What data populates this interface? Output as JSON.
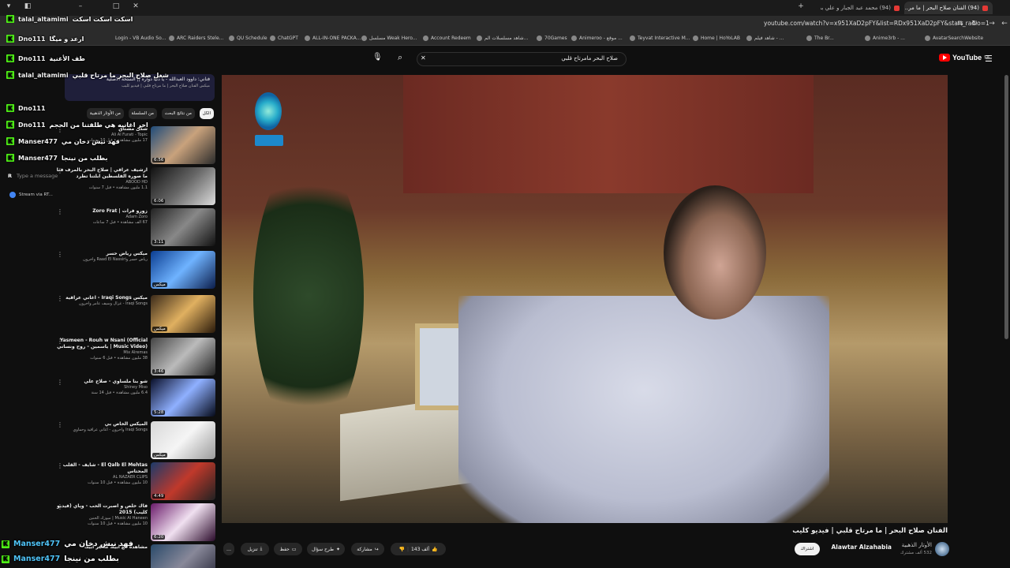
{
  "browser": {
    "tabs": [
      {
        "label": "(94) الفنان صلاح البحر | ما مر...",
        "active": true
      },
      {
        "label": "(94) محمد عبد الجبار و علي بدر ...",
        "active": false
      }
    ],
    "new_tab": "+",
    "url": "youtube.com/watch?v=x951XaD2pFY&list=RDx951XaD2pFY&start_radio=1",
    "bookmarks": [
      "Login - VB Audio So...",
      "ARC Raiders Stele...",
      "QU Schedule",
      "ChatGPT",
      "ALL-IN-ONE PACKA...",
      "مسلسل Weak Hero...",
      "Account Redeem",
      "شاهد مسلسلات الم...",
      "70Games",
      "Animeroo - موقع ...",
      "Teyvat Interactive M...",
      "Home | HoYoLAB",
      "شاهد فيلم - ...",
      "The Br...",
      "Anime3rb - ...",
      "AvatarSearchWebsite"
    ]
  },
  "youtube": {
    "search_value": "صلاح البحر مامرتاح قلبي",
    "logo_text": "YouTube",
    "logo_region": "SA"
  },
  "video": {
    "title": "الفنان صلاح البحر | ما مرتاح قلبي | فيديو كليب",
    "channel_name": "Alawtar Alzahabia",
    "channel_name_ar": "الأوتار الذهبية",
    "channel_subs": "532 ألف مشترك",
    "subscribe_label": "اشتراك",
    "likes": "143 ألف",
    "share_label": "مشاركة",
    "ask_label": "طرح سؤال",
    "save_label": "حفظ",
    "download_label": "تنزيل",
    "more_label": "…"
  },
  "sidebar": {
    "mix_title": "فناني: داوود العبدالله - يا دنيا دواره || النسخة الاصلية",
    "mix_sub": "ميكس الفنان صلاح البحر | ما مرتاح قلبي | فيديو كليب",
    "chips": [
      "الكل",
      "من نتائج البحث",
      "من السلسلة",
      "من الأوتار الذهبية"
    ],
    "recs": [
      {
        "title": "شكل مشتاق",
        "channel": "Ali Al Furati - Topic",
        "meta": "17 مليون مشاهدة • قبل 10 سنوات",
        "duration": "6:56"
      },
      {
        "title": "ارشيف عراقي | صلاح البحر بالمرف فنا ما صوره الفلسطين ابلتنا تطرد",
        "channel": "ABOOD HD",
        "meta": "1.1 مليون مشاهدة • قبل 7 سنوات",
        "duration": "6:06"
      },
      {
        "title": "زورو فرات | Zoro Frat",
        "channel": "Adam Zoro",
        "meta": "67 ألف مشاهدة • قبل 7 ساعات",
        "duration": "3:11"
      },
      {
        "title": "ميكس رياض حسر",
        "channel": "رياض حسر وRaad El Nassiri وآخرون",
        "meta": "",
        "duration": "ميكس"
      },
      {
        "title": "ميكس Iraqi Songs - اغاني عراقية",
        "channel": "Iraqi Songs - غزال وسيف عامر وآخرون",
        "meta": "",
        "duration": "ميكس"
      },
      {
        "title": "Yasmeen - Rouh w Nsani (Official Music Video) | ياسمين - روح ونساني",
        "channel": "Mix Alremas",
        "meta": "38 مليون مشاهدة • قبل 6 سنوات",
        "duration": "3:46"
      },
      {
        "title": "شو بنا ملساوي - صلاح علي",
        "channel": "Shiney Miso",
        "meta": "6.4 مليون مشاهدة • قبل 14 سنة",
        "duration": "5:28"
      },
      {
        "title": "الميكس الخاص بي",
        "channel": "Iraqi Songs وآخرون - اغاني عراقية وحماوي",
        "meta": "",
        "duration": "ميكس"
      },
      {
        "title": "El Qalb El Mehtas - شايف - القلب المحتاس",
        "channel": "AL NAZAER CLIPS",
        "meta": "10 مليون مشاهدة • قبل 10 سنوات",
        "duration": "4:49"
      },
      {
        "title": "فاك خلص و اصبرت الحب - وياي (فيديو كليب) 2015",
        "channel": "Music Al Haneen | ميوزك الحنين",
        "meta": "10 مليون مشاهدة • قبل 10 سنوات",
        "duration": "6:20"
      },
      {
        "title": "مشاهدة مع ابيك شاهر ابيك",
        "channel": "",
        "meta": "",
        "duration": ""
      }
    ]
  },
  "chat_overlay": {
    "messages": [
      {
        "user": "talal_altamimi",
        "color": "#ffffff",
        "text": "اسكت اسكت اسكت"
      },
      {
        "user": "Dno111",
        "color": "#ffffff",
        "text": "ارعد و ميگا"
      },
      {
        "user": "Dno111",
        "color": "#ffffff",
        "text": "طف الأغنية"
      },
      {
        "user": "talal_altamimi",
        "color": "#ffffff",
        "text": "شغل صلاح البحر ما مرتاح قلبي"
      },
      {
        "user": "Dno111",
        "color": "#ffffff",
        "text": ""
      },
      {
        "user": "Dno111",
        "color": "#ffffff",
        "text": "اخر اغانيه هي طلقتنا من الحجم"
      },
      {
        "user": "Manser477",
        "color": "#ffffff",
        "text": "فهد نيش دخان مي"
      },
      {
        "user": "Manser477",
        "color": "#ffffff",
        "text": "بطلب من نينجا"
      }
    ],
    "input_placeholder": "Type a message",
    "stream_label": "Stream via RT...",
    "bottom": [
      {
        "user": "Manser477",
        "text": "فهد نيش دخان مي"
      },
      {
        "user": "Manser477",
        "text": "بطلب من نينجا"
      }
    ]
  },
  "colors": {
    "kick_green": "#53fc18",
    "youtube_red": "#ff0000",
    "chat_name": "#ffffff"
  },
  "icons": [
    "mic-icon",
    "search-icon",
    "close-icon",
    "menu-icon",
    "like-icon",
    "dislike-icon",
    "share-icon",
    "save-icon",
    "download-icon",
    "more-icon"
  ]
}
